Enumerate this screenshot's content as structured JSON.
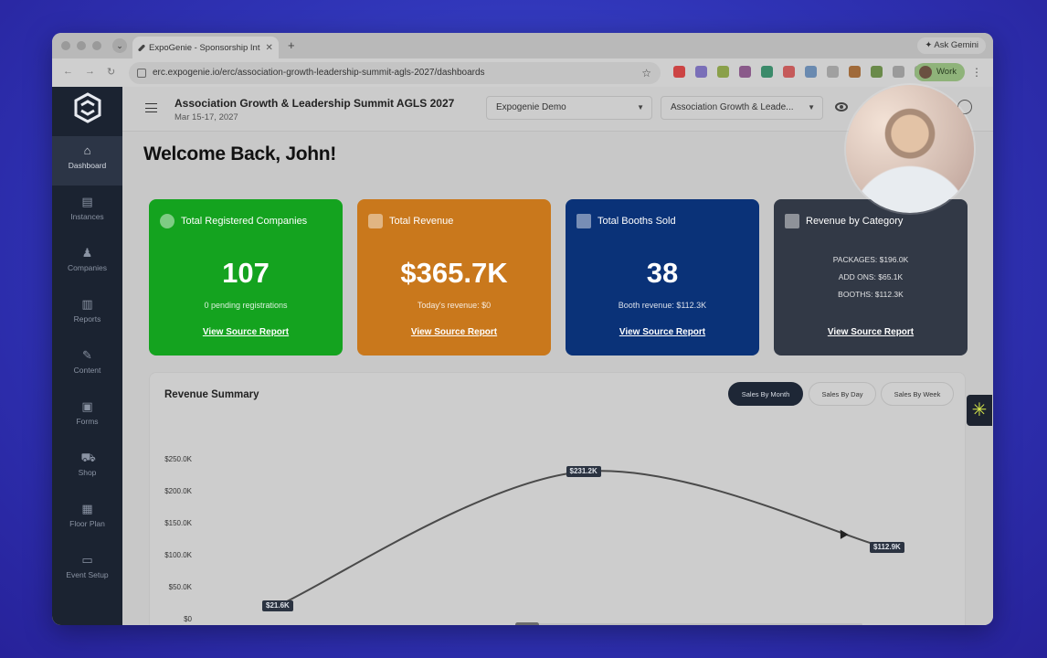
{
  "browser": {
    "tab_title": "ExpoGenie - Sponsorship Int",
    "ask_gemini": "Ask Gemini",
    "url": "erc.expogenie.io/erc/association-growth-leadership-summit-agls-2027/dashboards",
    "profile_label": "Work"
  },
  "sidebar": {
    "items": [
      {
        "label": "Dashboard",
        "icon": "home-icon"
      },
      {
        "label": "Instances",
        "icon": "document-icon"
      },
      {
        "label": "Companies",
        "icon": "users-icon"
      },
      {
        "label": "Reports",
        "icon": "chart-icon"
      },
      {
        "label": "Content",
        "icon": "edit-icon"
      },
      {
        "label": "Forms",
        "icon": "forms-icon"
      },
      {
        "label": "Shop",
        "icon": "cart-icon"
      },
      {
        "label": "Floor Plan",
        "icon": "map-icon"
      },
      {
        "label": "Event Setup",
        "icon": "calendar-icon"
      }
    ]
  },
  "header": {
    "event_title": "Association Growth & Leadership Summit AGLS 2027",
    "event_date": "Mar 15-17, 2027",
    "org_select": "Expogenie Demo",
    "event_select": "Association Growth & Leade..."
  },
  "welcome": "Welcome Back, John!",
  "cards": [
    {
      "title": "Total Registered Companies",
      "value": "107",
      "sub": "0 pending registrations",
      "link": "View Source Report",
      "color": "#14a31f"
    },
    {
      "title": "Total Revenue",
      "value": "$365.7K",
      "sub": "Today's revenue: $0",
      "link": "View Source Report",
      "color": "#c9781c"
    },
    {
      "title": "Total Booths Sold",
      "value": "38",
      "sub": "Booth revenue: $112.3K",
      "link": "View Source Report",
      "color": "#0a3278"
    },
    {
      "title": "Revenue by Category",
      "lines": [
        "PACKAGES: $196.0K",
        "ADD ONS: $65.1K",
        "BOOTHS: $112.3K"
      ],
      "link": "View Source Report",
      "color": "#323946"
    }
  ],
  "revenue_summary": {
    "title": "Revenue Summary",
    "buttons": [
      "Sales By Month",
      "Sales By Day",
      "Sales By Week"
    ],
    "active_button": "Sales By Month"
  },
  "chart_data": {
    "type": "line",
    "title": "Revenue Summary",
    "ylabels": [
      "$250.0K",
      "$200.0K",
      "$150.0K",
      "$100.0K",
      "$50.0K",
      "$0"
    ],
    "ylim": [
      0,
      250000
    ],
    "points": [
      {
        "x": 0,
        "y": 21600,
        "label": "$21.6K"
      },
      {
        "x": 1,
        "y": 231200,
        "label": "$231.2K"
      },
      {
        "x": 2,
        "y": 112900,
        "label": "$112.9K"
      }
    ],
    "grid": false,
    "line_color": "#4a4a4a"
  },
  "colors": {
    "sidebar": "#1b2331",
    "accent_dark": "#1e2736"
  }
}
